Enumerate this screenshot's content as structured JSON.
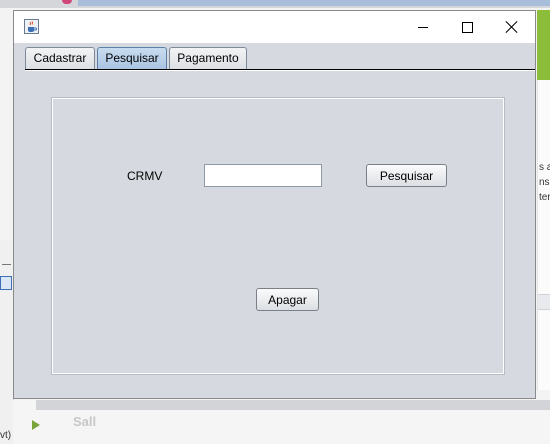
{
  "window": {
    "title": "",
    "controls": {
      "minimize": "",
      "maximize": "",
      "close": ""
    }
  },
  "tabs": [
    {
      "label": "Cadastrar",
      "selected": false
    },
    {
      "label": "Pesquisar",
      "selected": true
    },
    {
      "label": "Pagamento",
      "selected": false
    }
  ],
  "search_form": {
    "crmv_label": "CRMV",
    "crmv_value": "",
    "search_button": "Pesquisar",
    "clear_button": "Apagar"
  },
  "background": {
    "right_fragments": [
      "s a",
      "ns",
      "ter."
    ],
    "left_fragment": "vt)",
    "bottom_fragment": "Sall"
  },
  "icons": {
    "app": "java-coffee-cup-icon",
    "minimize": "minimize-icon",
    "maximize": "maximize-icon",
    "close": "close-icon"
  },
  "colors": {
    "window_bg": "#d6d9df",
    "selected_tab": "#a9c4e2",
    "titlebar": "#ffffff"
  }
}
